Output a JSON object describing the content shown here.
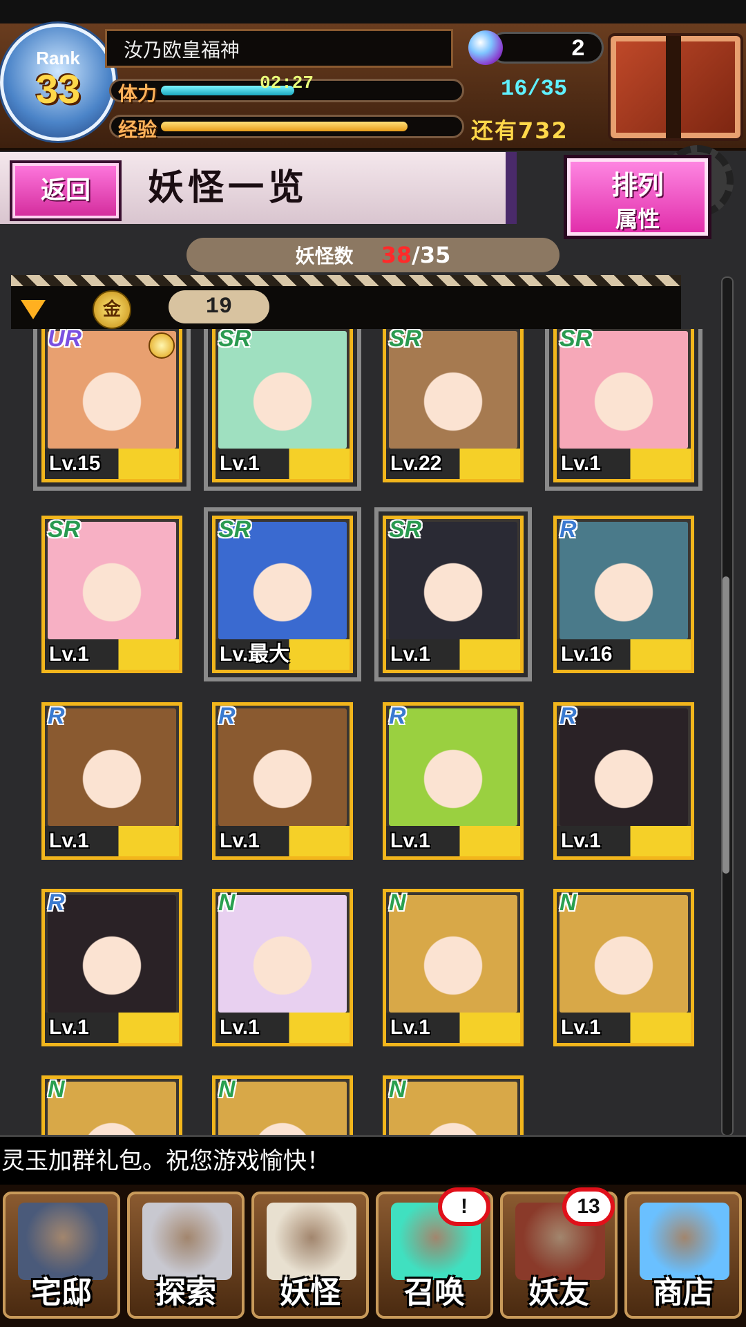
{
  "header": {
    "rank_label": "Rank",
    "rank_value": "33",
    "player_name": "汝乃欧皇福神",
    "spirit_orbs": "2",
    "stamina_label": "体力",
    "stamina_timer": "02:27",
    "stamina_value": "16/35",
    "stamina_fraction": 0.46,
    "exp_label": "经验",
    "exp_remaining": "还有732",
    "exp_fraction": 0.87
  },
  "titlebar": {
    "back_label": "返回",
    "title": "妖怪一览",
    "sort_label": "排列",
    "sort_value": "属性"
  },
  "count": {
    "label": "妖怪数",
    "current": "38",
    "separator": "/",
    "max": "35"
  },
  "filter": {
    "coin_glyph": "金",
    "coin_value": "19"
  },
  "cards": [
    {
      "rarity": "UR",
      "level": "Lv.15",
      "medal": true,
      "color": "#e8a070"
    },
    {
      "rarity": "SR",
      "level": "Lv.1",
      "medal": false,
      "color": "#9fe0c0"
    },
    {
      "rarity": "SR",
      "level": "Lv.22",
      "medal": false,
      "color": "#a67a50"
    },
    {
      "rarity": "SR",
      "level": "Lv.1",
      "medal": false,
      "color": "#f6a8b8"
    },
    {
      "rarity": "SR",
      "level": "Lv.1",
      "medal": false,
      "color": "#f7b0c4"
    },
    {
      "rarity": "SR",
      "level": "Lv.最大",
      "medal": false,
      "color": "#3a6ad0"
    },
    {
      "rarity": "SR",
      "level": "Lv.1",
      "medal": false,
      "color": "#2a2a34"
    },
    {
      "rarity": "R",
      "level": "Lv.16",
      "medal": false,
      "color": "#4a7a8a"
    },
    {
      "rarity": "R",
      "level": "Lv.1",
      "medal": false,
      "color": "#8a5a30"
    },
    {
      "rarity": "R",
      "level": "Lv.1",
      "medal": false,
      "color": "#8a5a30"
    },
    {
      "rarity": "R",
      "level": "Lv.1",
      "medal": false,
      "color": "#9ad040"
    },
    {
      "rarity": "R",
      "level": "Lv.1",
      "medal": false,
      "color": "#2a2226"
    },
    {
      "rarity": "R",
      "level": "Lv.1",
      "medal": false,
      "color": "#2a2226"
    },
    {
      "rarity": "N",
      "level": "Lv.1",
      "medal": false,
      "color": "#e8d0f0"
    },
    {
      "rarity": "N",
      "level": "Lv.1",
      "medal": false,
      "color": "#d8a848"
    },
    {
      "rarity": "N",
      "level": "Lv.1",
      "medal": false,
      "color": "#d8a848"
    },
    {
      "rarity": "N",
      "level": "",
      "medal": false,
      "color": "#d8a848"
    },
    {
      "rarity": "N",
      "level": "",
      "medal": false,
      "color": "#d8a848"
    },
    {
      "rarity": "N",
      "level": "",
      "medal": false,
      "color": "#d8a848"
    }
  ],
  "selected_cards": [
    0,
    1,
    3,
    5,
    6
  ],
  "rarity_colors": {
    "UR": "#7a50e0",
    "SR": "#2a9a50",
    "R": "#3a7ad0",
    "N": "#2aa050"
  },
  "ticker": "灵玉加群礼包。祝您游戏愉快！",
  "nav": [
    {
      "label": "宅邸",
      "icon": "mansion-icon",
      "color": "#4a5a7a",
      "badge": ""
    },
    {
      "label": "探索",
      "icon": "magnifier-icon",
      "color": "#c8c8d0",
      "badge": ""
    },
    {
      "label": "妖怪",
      "icon": "scroll-icon",
      "color": "#e8e0d0",
      "badge": ""
    },
    {
      "label": "召唤",
      "icon": "pentagram-icon",
      "color": "#40e0c0",
      "badge": "!"
    },
    {
      "label": "妖友",
      "icon": "friend-icon",
      "color": "#8a3a2a",
      "badge": "13"
    },
    {
      "label": "商店",
      "icon": "orb-icon",
      "color": "#6ac0ff",
      "badge": ""
    }
  ]
}
